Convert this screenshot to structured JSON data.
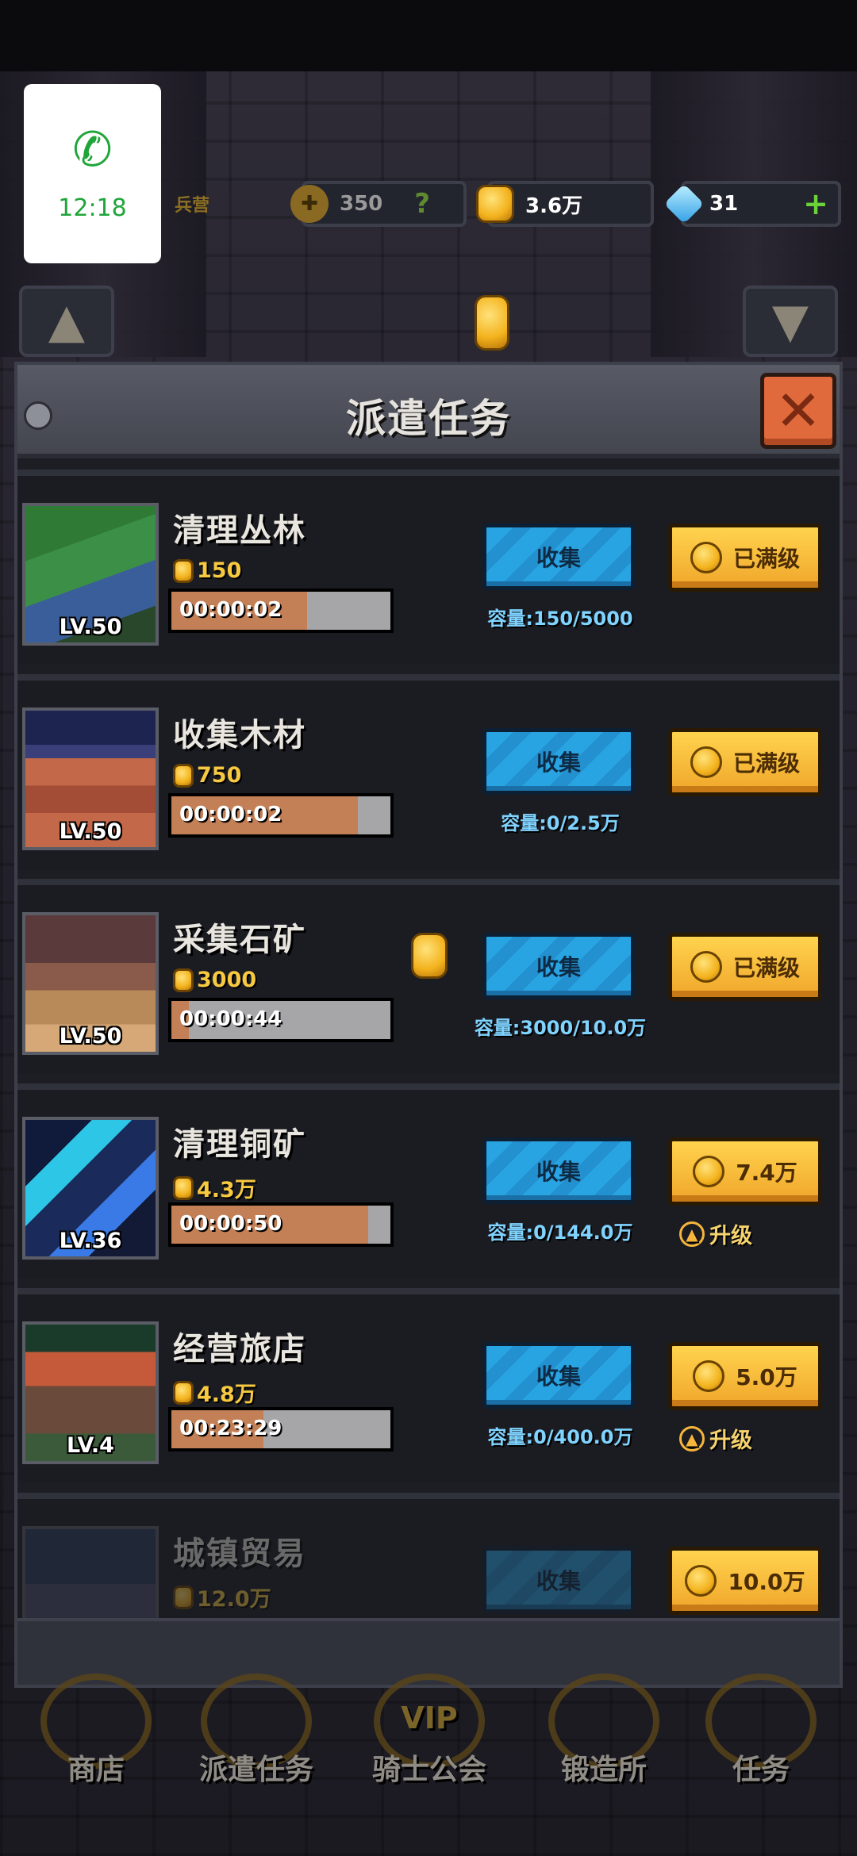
{
  "status": {
    "call_time": "12:18"
  },
  "resources": {
    "energy": "350",
    "energy_hint": "?",
    "gold": "3.6万",
    "gems": "31",
    "gems_add": "+",
    "faded_label": "兵营"
  },
  "panel": {
    "title": "派遣任务",
    "close_glyph": "✕"
  },
  "missions": [
    {
      "name": "清理丛林",
      "level": "LV.50",
      "reward": "150",
      "timer": "00:00:02",
      "progress": 0.62,
      "collect": "收集",
      "capacity": "容量:150/5000",
      "action": "已满级",
      "can_upgrade": false
    },
    {
      "name": "收集木材",
      "level": "LV.50",
      "reward": "750",
      "timer": "00:00:02",
      "progress": 0.85,
      "collect": "收集",
      "capacity": "容量:0/2.5万",
      "action": "已满级",
      "can_upgrade": false
    },
    {
      "name": "采集石矿",
      "level": "LV.50",
      "reward": "3000",
      "timer": "00:00:44",
      "progress": 0.08,
      "collect": "收集",
      "capacity": "容量:3000/10.0万",
      "action": "已满级",
      "can_upgrade": false
    },
    {
      "name": "清理铜矿",
      "level": "LV.36",
      "reward": "4.3万",
      "timer": "00:00:50",
      "progress": 0.9,
      "collect": "收集",
      "capacity": "容量:0/144.0万",
      "action": "7.4万",
      "can_upgrade": true,
      "upgrade_label": "升级"
    },
    {
      "name": "经营旅店",
      "level": "LV.4",
      "reward": "4.8万",
      "timer": "00:23:29",
      "progress": 0.42,
      "collect": "收集",
      "capacity": "容量:0/400.0万",
      "action": "5.0万",
      "can_upgrade": true,
      "upgrade_label": "升级"
    },
    {
      "name": "城镇贸易",
      "level": "",
      "reward": "12.0万",
      "timer": "",
      "progress": 0,
      "collect": "收集",
      "capacity": "",
      "action": "10.0万",
      "can_upgrade": false
    }
  ],
  "nav": [
    {
      "label": "商店"
    },
    {
      "label": "派遣任务"
    },
    {
      "label": "骑士公会",
      "badge": "VIP"
    },
    {
      "label": "锻造所"
    },
    {
      "label": "任务"
    }
  ],
  "colors": {
    "accent_blue": "#29a4e2",
    "gold": "#f6c940",
    "progress": "#c37f55"
  }
}
